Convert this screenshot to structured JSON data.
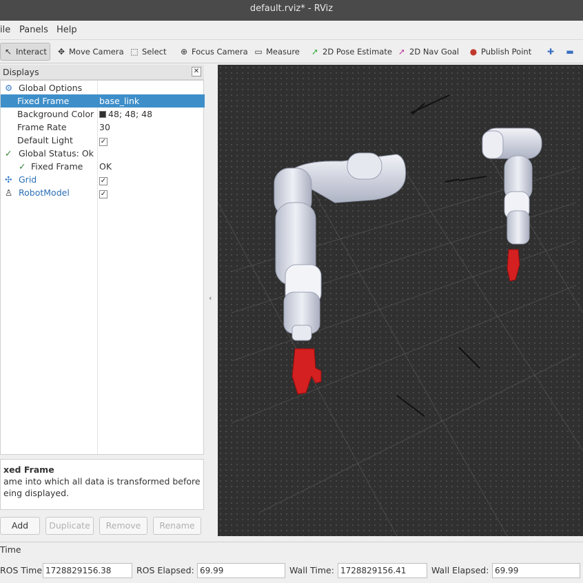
{
  "window": {
    "title": "default.rviz* - RViz"
  },
  "menu": [
    "ile",
    "Panels",
    "Help"
  ],
  "toolbar": {
    "interact": "Interact",
    "move_camera": "Move Camera",
    "select": "Select",
    "focus_camera": "Focus Camera",
    "measure": "Measure",
    "pose_estimate": "2D Pose Estimate",
    "nav_goal": "2D Nav Goal",
    "publish_point": "Publish Point"
  },
  "displays": {
    "title": "Displays",
    "rows": [
      {
        "key": "Global Options",
        "value": ""
      },
      {
        "key": "Fixed Frame",
        "value": "base_link"
      },
      {
        "key": "Background Color",
        "value": "48; 48; 48"
      },
      {
        "key": "Frame Rate",
        "value": "30"
      },
      {
        "key": "Default Light",
        "value": "✓"
      },
      {
        "key": "Global Status: Ok",
        "value": ""
      },
      {
        "key": "Fixed Frame",
        "value": "OK"
      },
      {
        "key": "Grid",
        "value": "✓"
      },
      {
        "key": "RobotModel",
        "value": "✓"
      }
    ],
    "description_title": "xed Frame",
    "description_line1": "ame into which all data is transformed before",
    "description_line2": "eing displayed.",
    "buttons": {
      "add": "Add",
      "duplicate": "Duplicate",
      "remove": "Remove",
      "rename": "Rename"
    }
  },
  "time": {
    "title": "Time",
    "ros_time_label": "ROS Time:",
    "ros_time": "1728829156.38",
    "ros_elapsed_label": "ROS Elapsed:",
    "ros_elapsed": "69.99",
    "wall_time_label": "Wall Time:",
    "wall_time": "1728829156.41",
    "wall_elapsed_label": "Wall Elapsed:",
    "wall_elapsed": "69.99"
  },
  "colors": {
    "background": "#303030",
    "gripper": "#d42020",
    "arm": "#dfe2ec",
    "selection": "#3d8ec9"
  }
}
